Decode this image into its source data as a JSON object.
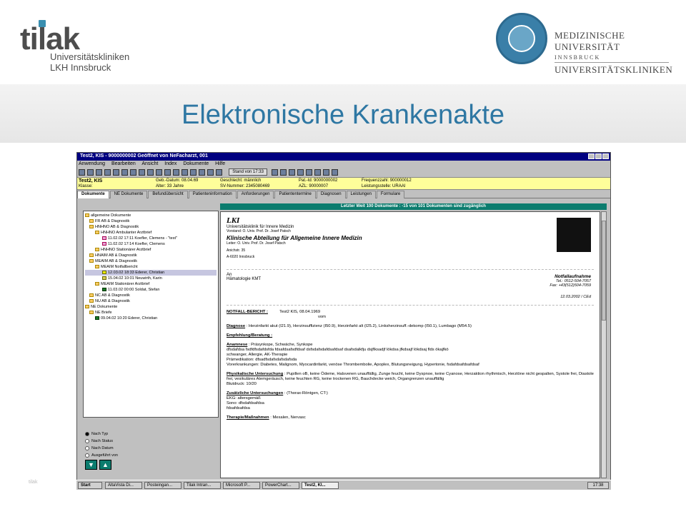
{
  "header": {
    "tilak_word": "tilak",
    "tilak_line1": "Universitätskliniken",
    "tilak_line2": "LKH Innsbruck",
    "muni_line1": "MEDIZINISCHE UNIVERSITÄT",
    "muni_line2": "INNSBRUCK",
    "muni_line3": "UNIVERSITÄTSKLINIKEN"
  },
  "slide_title": "Elektronische Krankenakte",
  "window": {
    "title": "Test2, KIS - 9000000002 Geöffnet von NeFacharzt, 001",
    "menu": [
      "Anwendung",
      "Bearbeiten",
      "Ansicht",
      "Index",
      "Dokumente",
      "Hilfe"
    ],
    "stand": "Stand von 17:33"
  },
  "patient": {
    "name": "Test2, KIS",
    "klasse": "Klasse:",
    "geb": "Geb.-Datum: 08.04.69",
    "alter": "Alter: 33 Jahre",
    "geschlecht": "Geschlecht: männlich",
    "sv": "SV-Nummer: 2345080469",
    "patid": "Pat.-Id: 9000000002",
    "azl": "AZL: 90000007",
    "frequenz": "Frequenzzahl: 900000012",
    "leistung": "Leistungsstelle: URAAI"
  },
  "tabs": [
    "Dokumente",
    "NE Dokumente",
    "Befundübersicht",
    "Patienteninformation",
    "Anforderungen",
    "Patiententermine",
    "Diagnosen",
    "Leistungen",
    "Formulare"
  ],
  "tree": [
    "allgemeine Dokumente",
    "FR AB & Diagnostik",
    "HNHNO AB & Diagnostik",
    "HNHNO Ambulanter Arztbrief",
    "11.02.02 17:11  Koefler, Clemens - \"test\"",
    "11.02.02 17:14  Koefler, Clemens",
    "HNHNO Stationärer Arztbrief",
    "HNAIM AB & Diagnostik",
    "MEAIM AB & Diagnostik",
    "MEAIM Notfallbericht",
    "12.03.02 18:33  Ederer, Christian",
    "15.04.02 10:01  Neuwirth, Karin",
    "MEAIM Stationärer Arztbrief",
    "11.03.02 00:00  Soldat, Stefan",
    "NC AB & Diagnostik",
    "NU AB & Diagnostik",
    "NE Dokumente",
    "NE Briefe",
    "09.04.02 10:20  Ederer, Christian"
  ],
  "sort": [
    "Nach Typ",
    "Nach Status",
    "Nach Datum",
    "Ausgeführt von"
  ],
  "docbar": "Letzter Weit 100 Dokumente : -15 von 101 Dokumenten sind zugänglich",
  "doc": {
    "lki": "LKI",
    "univ": "Universitätsklinik für Innere Medizin",
    "vorstand": "Vorstand: O. Univ. Prof. Dr. Josef Patsch",
    "clinic": "Klinische Abteilung für Allgemeine Innere Medizin",
    "leiter": "Leiter: O. Univ. Prof. Dr. Josef Patsch",
    "anichstr": "Anichstr. 35",
    "city": "A-6020 Innsbruck",
    "an": "An",
    "haem": "Hämatologie KMT",
    "notfall_title": "Notfallaufnahme",
    "tel": "Tel.: 0512-504-7057",
    "fax": "Fax: +43(512)504-7059",
    "date_ced": "12.03.2002 / CEd",
    "bericht_label": "NOTFALL-BERICHT :",
    "bericht_pat": "Test2 KIS, 08.04.1969",
    "vom": "vom",
    "diagnose_label": "Diagnose",
    "diagnose_text": ": Herzinfarkt akut (I21.9), Herzinsuffizienz (I50.9), Herzinfarkt alt (I25.2), Linksherzinsuff.-dekomp (I50.1), Lumbago (M54.5)",
    "empfehlung": "Empfehlung/Beratung :",
    "anamnese_label": "Anamnese",
    "anamnese_text": ": Präsynkope, Schwäche, Synkope",
    "anamnese_l2": "dfsdafdsa fsdfdfsdafdsfda fdsafdsafsdfdsaf dsfsdafsdafdsafdsaf dsafsdalkfju dsjflksadjf lökdsa jfkdsajf lökdsaj flds ökajfkö",
    "anamnese_l3": "schwanger, Allergie, AK-Therapie",
    "anamnese_l4": "Prämedikation: dfsadfsdafsdafsdafsda",
    "anamnese_l5": "Vorerkrankungen: Diabetes, Malignom, Myocardinfarkt, venöse Thrombembolie, Apoplex, Blutungsneigung, Hypertonie, fsdafdsafdsafdsaf",
    "phys_label": "Physikalische Untersuchung",
    "phys_text": ": Pupillen oB, keine Ödeme, Halsvenen unauffällig, Zunge feucht, keine Dyspnoe, keine Cyanose, Herzaktion rhythmisch, Herztöne nicht gespalten, Systole frei, Diastole frei, vesikuläres Atemgeräusch, keine feuchten RG, keine trockenen RG, Bauchdecke weich, Organgrenzen unauffällig",
    "phys_rr": "Blutdruck: 10/20",
    "zus_label": "Zusätzliche Untersuchungen",
    "zus_text": ": (Thorax-Röntgen, CT:)",
    "ekg": "EKG: altersgemäß",
    "sono": "Sono: dfsdafdsafdsa",
    "zus_l4": "fdsafdsafdsa",
    "ther_label": "Therapie/Maßnahmen",
    "ther_text": ": Mexalen, Nervasc"
  },
  "taskbar": {
    "start": "Start",
    "items": [
      "AltaVista Di...",
      "Posteingan...",
      "Tilak Intran...",
      "Microsoft P...",
      "PowerChart...",
      "Test2, KI..."
    ],
    "clock": "17:38"
  },
  "footer": "tilak"
}
